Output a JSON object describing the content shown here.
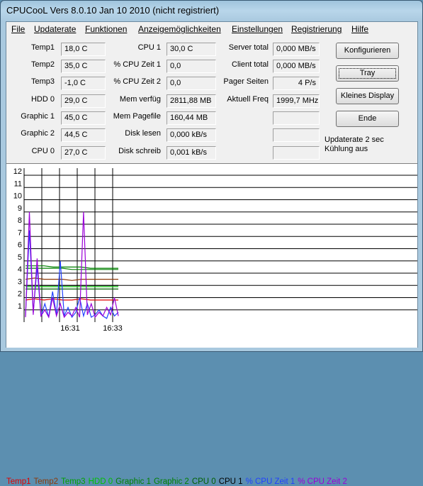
{
  "window": {
    "title": "CPUCooL  Vers 8.0.10  Jan 10 2010 (nicht registriert)"
  },
  "menu": [
    "File",
    "Updaterate",
    "Funktionen",
    "Anzeigemöglichkeiten",
    "Einstellungen",
    "Registrierung",
    "Hilfe"
  ],
  "col1": [
    {
      "label": "Temp1",
      "value": "18,0 C"
    },
    {
      "label": "Temp2",
      "value": "35,0 C"
    },
    {
      "label": "Temp3",
      "value": "-1,0 C"
    },
    {
      "label": "HDD 0",
      "value": "29,0 C"
    },
    {
      "label": "Graphic 1",
      "value": "45,0 C"
    },
    {
      "label": "Graphic 2",
      "value": "44,5 C"
    },
    {
      "label": "CPU 0",
      "value": "27,0 C"
    }
  ],
  "col2": [
    {
      "label": "CPU 1",
      "value": "30,0 C"
    },
    {
      "label": "% CPU Zeit 1",
      "value": "0,0"
    },
    {
      "label": "% CPU Zeit 2",
      "value": "0,0"
    },
    {
      "label": "Mem verfüg",
      "value": "2811,88 MB"
    },
    {
      "label": "Mem Pagefile",
      "value": "160,44 MB"
    },
    {
      "label": "Disk lesen",
      "value": "0,000 kB/s"
    },
    {
      "label": "Disk schreib",
      "value": "0,001 kB/s"
    }
  ],
  "col3": [
    {
      "label": "Server total",
      "value": "0,000 MB/s"
    },
    {
      "label": "Client total",
      "value": "0,000 MB/s"
    },
    {
      "label": "Pager Seiten",
      "value": "4 P/s"
    },
    {
      "label": "Aktuell Freq",
      "value": "1999,7 MHz"
    },
    {
      "label": "",
      "value": ""
    },
    {
      "label": "",
      "value": ""
    },
    {
      "label": "",
      "value": ""
    }
  ],
  "buttons": {
    "configure": "Konfigurieren",
    "tray": "Tray",
    "small_display": "Kleines Display",
    "end": "Ende"
  },
  "status": {
    "update_rate": "Updaterate 2 sec",
    "cooling": "Kühlung aus"
  },
  "legend": [
    {
      "text": "Temp1",
      "color": "#e00000"
    },
    {
      "text": "Temp2",
      "color": "#8b3a0a"
    },
    {
      "text": "Temp3",
      "color": "#00a000"
    },
    {
      "text": "HDD 0",
      "color": "#00c000"
    },
    {
      "text": "Graphic 1",
      "color": "#008000"
    },
    {
      "text": "Graphic 2",
      "color": "#008000"
    },
    {
      "text": "CPU 0",
      "color": "#006000"
    },
    {
      "text": "CPU 1",
      "color": "#000000"
    },
    {
      "text": "% CPU Zeit 1",
      "color": "#2040ff"
    },
    {
      "text": "% CPU Zeit 2",
      "color": "#9a00d8"
    }
  ],
  "chart_data": {
    "type": "line",
    "ylim": [
      0,
      12
    ],
    "yticks": [
      "1",
      "2",
      "3",
      "4",
      "5",
      "6",
      "7",
      "8",
      "9",
      "10",
      "11",
      "12"
    ],
    "xticks": [
      "16:31",
      "16:33"
    ],
    "grid": true,
    "series": [
      {
        "name": "Temp1",
        "color": "#e00000",
        "values": [
          1.8,
          1.9,
          1.8,
          1.9,
          1.8,
          1.8,
          1.9,
          1.8,
          1.8,
          1.8,
          1.8
        ]
      },
      {
        "name": "Temp2",
        "color": "#8b3a0a",
        "values": [
          3.5,
          3.6,
          3.5,
          3.5,
          3.5,
          3.4,
          3.5,
          3.5,
          3.5,
          3.5,
          3.5
        ]
      },
      {
        "name": "HDD 0",
        "color": "#00c000",
        "values": [
          2.9,
          2.9,
          2.9,
          2.9,
          2.9,
          2.9,
          2.9,
          2.9,
          2.9,
          2.9,
          2.9
        ]
      },
      {
        "name": "Graphic 1",
        "color": "#008000",
        "values": [
          4.6,
          4.6,
          4.6,
          4.5,
          4.5,
          4.5,
          4.5,
          4.4,
          4.4,
          4.4,
          4.4
        ]
      },
      {
        "name": "Graphic 2",
        "color": "#008000",
        "values": [
          4.4,
          4.4,
          4.4,
          4.4,
          4.4,
          4.3,
          4.3,
          4.3,
          4.3,
          4.3,
          4.3
        ]
      },
      {
        "name": "CPU 0",
        "color": "#006000",
        "values": [
          2.7,
          2.7,
          2.7,
          2.7,
          2.7,
          2.7,
          2.7,
          2.7,
          2.7,
          2.7,
          2.7
        ]
      },
      {
        "name": "CPU 1",
        "color": "#000000",
        "values": [
          3.0,
          3.0,
          3.0,
          3.0,
          3.0,
          3.0,
          3.0,
          3.0,
          3.0,
          3.0,
          3.0
        ]
      },
      {
        "name": "% CPU Zeit 1",
        "color": "#2040ff",
        "values": [
          0.5,
          7.5,
          0.8,
          4.5,
          0.5,
          1.5,
          0.4,
          2.5,
          0.6,
          5.0,
          0.5,
          1.2,
          0.4,
          0.8,
          2.0,
          0.5,
          1.5,
          0.4,
          0.6,
          1.0,
          0.5,
          0.3,
          1.2,
          0.5,
          0.8
        ]
      },
      {
        "name": "% CPU Zeit 2",
        "color": "#9a00d8",
        "values": [
          0.4,
          9.0,
          0.6,
          5.2,
          0.5,
          1.0,
          0.4,
          2.0,
          0.5,
          1.5,
          0.4,
          0.8,
          0.5,
          1.2,
          0.4,
          9.0,
          0.6,
          1.5,
          0.4,
          0.8,
          0.5,
          1.2,
          0.6,
          2.0,
          0.5
        ]
      }
    ]
  }
}
